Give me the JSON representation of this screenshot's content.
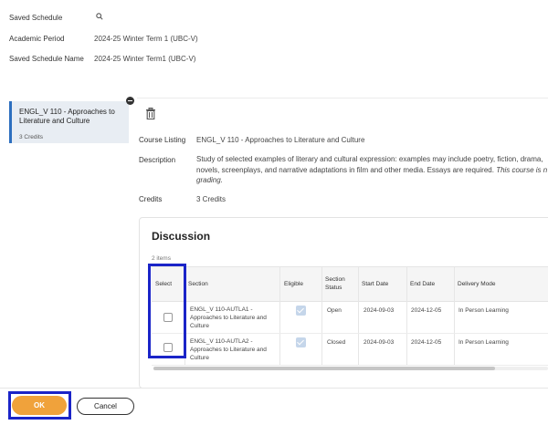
{
  "header": {
    "saved_schedule_label": "Saved Schedule",
    "academic_period_label": "Academic Period",
    "academic_period_value": "2024-25 Winter Term 1 (UBC-V)",
    "saved_schedule_name_label": "Saved Schedule Name",
    "saved_schedule_name_value": "2024-25 Winter Term1 (UBC-V)"
  },
  "card": {
    "title": "ENGL_V 110 - Approaches to Literature and Culture",
    "credits": "3 Credits"
  },
  "details": {
    "course_listing_label": "Course Listing",
    "course_listing_value": "ENGL_V 110 - Approaches to Literature and Culture",
    "description_label": "Description",
    "description_line1": "Study of selected examples of literary and cultural expression: examples may include poetry, fiction, drama, ",
    "description_line2": "novels, screenplays, and narrative adaptations in film and other media. Essays are required. ",
    "description_line2_italic": "This course is n",
    "description_line3_italic": "grading.",
    "credits_label": "Credits",
    "credits_value": "3 Credits"
  },
  "discussion": {
    "title": "Discussion",
    "items_count": "2 items",
    "columns": {
      "select": "Select",
      "section": "Section",
      "eligible": "Eligible",
      "section_status_1": "Section",
      "section_status_2": "Status",
      "start_date": "Start Date",
      "end_date": "End Date",
      "delivery_mode": "Delivery Mode"
    },
    "rows": [
      {
        "section_1": "ENGL_V 110-AUTLA1 -",
        "section_2": "Approaches to Literature and",
        "section_3": "Culture",
        "status": "Open",
        "start": "2024-09-03",
        "end": "2024-12-05",
        "mode": "In Person Learning"
      },
      {
        "section_1": "ENGL_V 110-AUTLA2 -",
        "section_2": "Approaches to Literature and",
        "section_3": "Culture",
        "status": "Closed",
        "start": "2024-09-03",
        "end": "2024-12-05",
        "mode": "In Person Learning"
      }
    ]
  },
  "footer": {
    "ok_label": "OK",
    "cancel_label": "Cancel"
  },
  "colors": {
    "accent": "#f0a23b",
    "highlight": "#1a24c8",
    "card_border": "#2d6fbf"
  }
}
